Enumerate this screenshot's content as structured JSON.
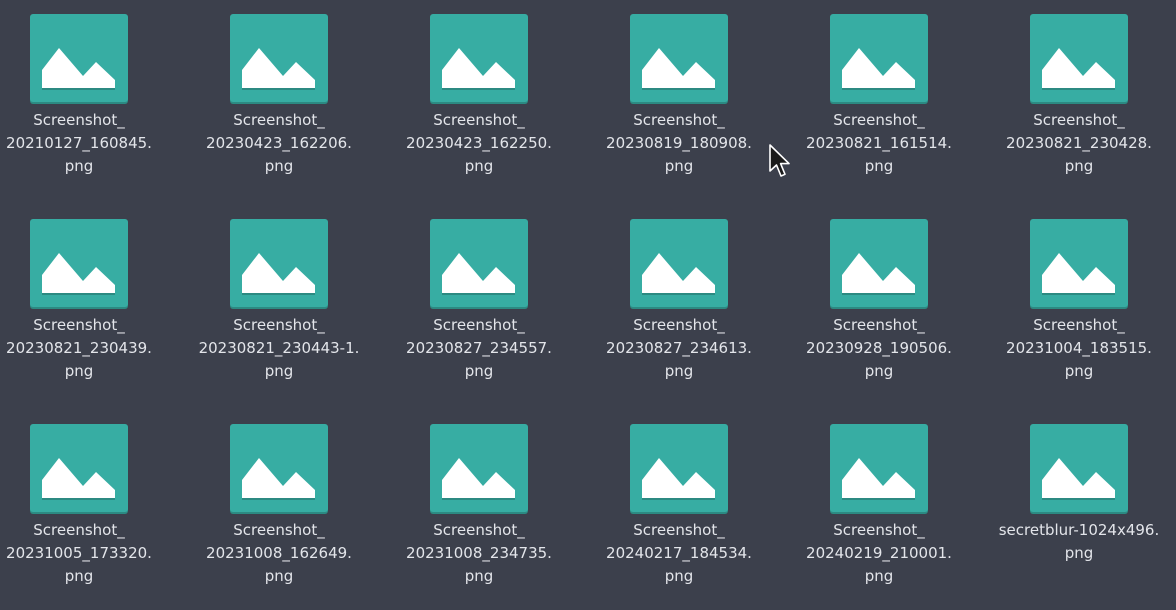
{
  "colors": {
    "background": "#3c404c",
    "icon_tile": "#37ada3",
    "icon_tile_shadow": "#2c8a82",
    "icon_mountain": "#ffffff",
    "label_text": "#e3e5ea"
  },
  "icons": {
    "file_type": "image-file-icon",
    "cursor": "mouse-pointer-icon"
  },
  "files": [
    {
      "lines": [
        "Screenshot_",
        "20210127_160845.",
        "png"
      ]
    },
    {
      "lines": [
        "Screenshot_",
        "20230423_162206.",
        "png"
      ]
    },
    {
      "lines": [
        "Screenshot_",
        "20230423_162250.",
        "png"
      ]
    },
    {
      "lines": [
        "Screenshot_",
        "20230819_180908.",
        "png"
      ]
    },
    {
      "lines": [
        "Screenshot_",
        "20230821_161514.",
        "png"
      ]
    },
    {
      "lines": [
        "Screenshot_",
        "20230821_230428.",
        "png"
      ]
    },
    {
      "lines": [
        "Screenshot_",
        "20230821_230439.",
        "png"
      ]
    },
    {
      "lines": [
        "Screenshot_",
        "20230821_230443-1.",
        "png"
      ]
    },
    {
      "lines": [
        "Screenshot_",
        "20230827_234557.",
        "png"
      ]
    },
    {
      "lines": [
        "Screenshot_",
        "20230827_234613.",
        "png"
      ]
    },
    {
      "lines": [
        "Screenshot_",
        "20230928_190506.",
        "png"
      ]
    },
    {
      "lines": [
        "Screenshot_",
        "20231004_183515.",
        "png"
      ]
    },
    {
      "lines": [
        "Screenshot_",
        "20231005_173320.",
        "png"
      ]
    },
    {
      "lines": [
        "Screenshot_",
        "20231008_162649.",
        "png"
      ]
    },
    {
      "lines": [
        "Screenshot_",
        "20231008_234735.",
        "png"
      ]
    },
    {
      "lines": [
        "Screenshot_",
        "20240217_184534.",
        "png"
      ]
    },
    {
      "lines": [
        "Screenshot_",
        "20240219_210001.",
        "png"
      ]
    },
    {
      "lines": [
        "secretblur-1024x496.",
        "png"
      ]
    }
  ]
}
